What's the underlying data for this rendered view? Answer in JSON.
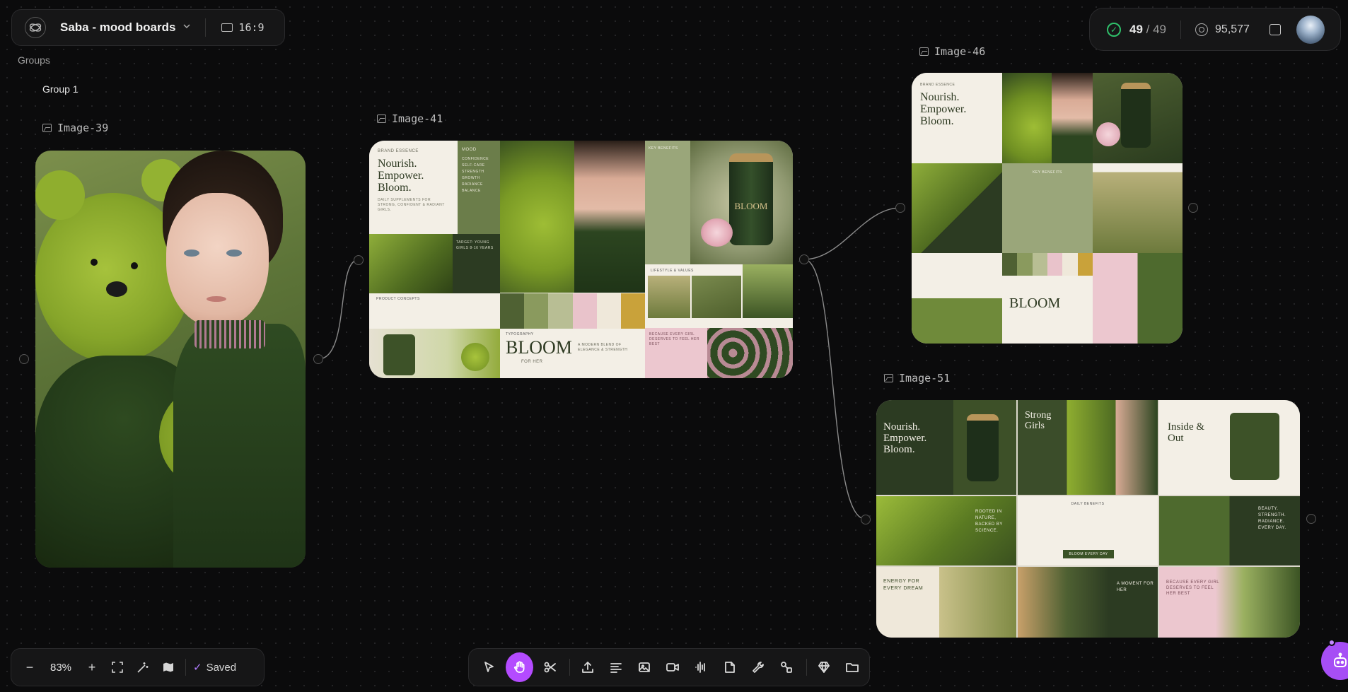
{
  "project": {
    "title": "Saba - mood boards",
    "aspect_ratio": "16:9"
  },
  "canvas": {
    "groups_label": "Groups",
    "group_name": "Group 1"
  },
  "images": [
    {
      "label": "Image-39"
    },
    {
      "label": "Image-41"
    },
    {
      "label": "Image-46"
    },
    {
      "label": "Image-51"
    }
  ],
  "board41": {
    "brand_essence": "BRAND ESSENCE",
    "headline": "Nourish. Empower. Bloom.",
    "subline": "DAILY SUPPLEMENTS FOR STRONG, CONFIDENT & RADIANT GIRLS.",
    "mood_title": "MOOD",
    "mood_items": "CONFIDENCE SELF-CARE STRENGTH GROWTH RADIANCE BALANCE",
    "key_benefits": "KEY BENEFITS",
    "target": "TARGET: YOUNG GIRLS 8-16 YEARS",
    "product_concepts": "PRODUCT CONCEPTS",
    "typography": "TYPOGRAPHY",
    "wordmark": "BLOOM",
    "wordmark_sub": "FOR HER",
    "blend": "A MODERN BLEND OF ELEGANCE & STRENGTH",
    "lifestyle": "LIFESTYLE & VALUES",
    "tagline": "BECAUSE EVERY GIRL DESERVES TO FEEL HER BEST",
    "jar": "BLOOM"
  },
  "board51": {
    "headline": "Nourish. Empower. Bloom.",
    "strong": "Strong Girls",
    "inside": "Inside & Out",
    "rooted": "ROOTED IN NATURE, BACKED BY SCIENCE.",
    "beauty": "BEAUTY. STRENGTH. RADIANCE. EVERY DAY.",
    "energy": "ENERGY FOR EVERY DREAM",
    "moment": "A MOMENT FOR HER",
    "deserves": "BECAUSE EVERY GIRL DESERVES TO FEEL HER BEST",
    "bloom_every_day": "BLOOM EVERY DAY",
    "daily_benefits": "DAILY BENEFITS"
  },
  "status": {
    "done": "49",
    "total": "49",
    "credits": "95,577"
  },
  "zoom": {
    "level": "83%",
    "saved": "Saved"
  },
  "colors": {
    "accent": "#b44bff",
    "success": "#2fc06a",
    "moss": "#6f8a3a",
    "deep_green": "#2c3b22",
    "sage": "#9aa67a",
    "cream": "#f3efe6",
    "blush": "#ecc7cf"
  }
}
